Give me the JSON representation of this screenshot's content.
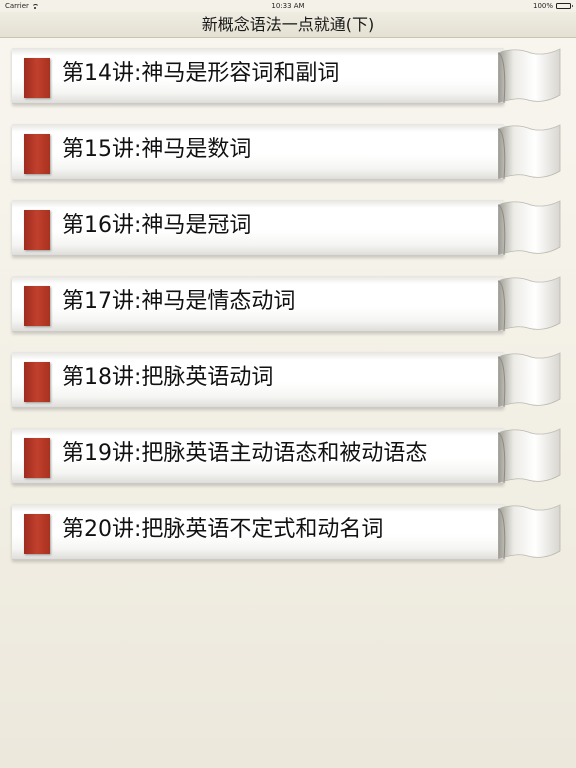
{
  "status_bar": {
    "carrier": "Carrier",
    "time": "10:33 AM",
    "battery": "100%"
  },
  "nav": {
    "title": "新概念语法一点就通(下)"
  },
  "lessons": [
    {
      "label": "第14讲:神马是形容词和副词"
    },
    {
      "label": "第15讲:神马是数词"
    },
    {
      "label": "第16讲:神马是冠词"
    },
    {
      "label": "第17讲:神马是情态动词"
    },
    {
      "label": "第18讲:把脉英语动词"
    },
    {
      "label": "第19讲:把脉英语主动语态和被动语态"
    },
    {
      "label": "第20讲:把脉英语不定式和动名词"
    }
  ],
  "icons": {
    "signal": "wifi-icon",
    "battery": "battery-icon",
    "bookmark": "bookmark-icon",
    "curl": "page-curl-icon"
  },
  "colors": {
    "bookmark": "#b5382a",
    "background": "#f3f0e6",
    "nav_bar": "#e8e5d8"
  }
}
